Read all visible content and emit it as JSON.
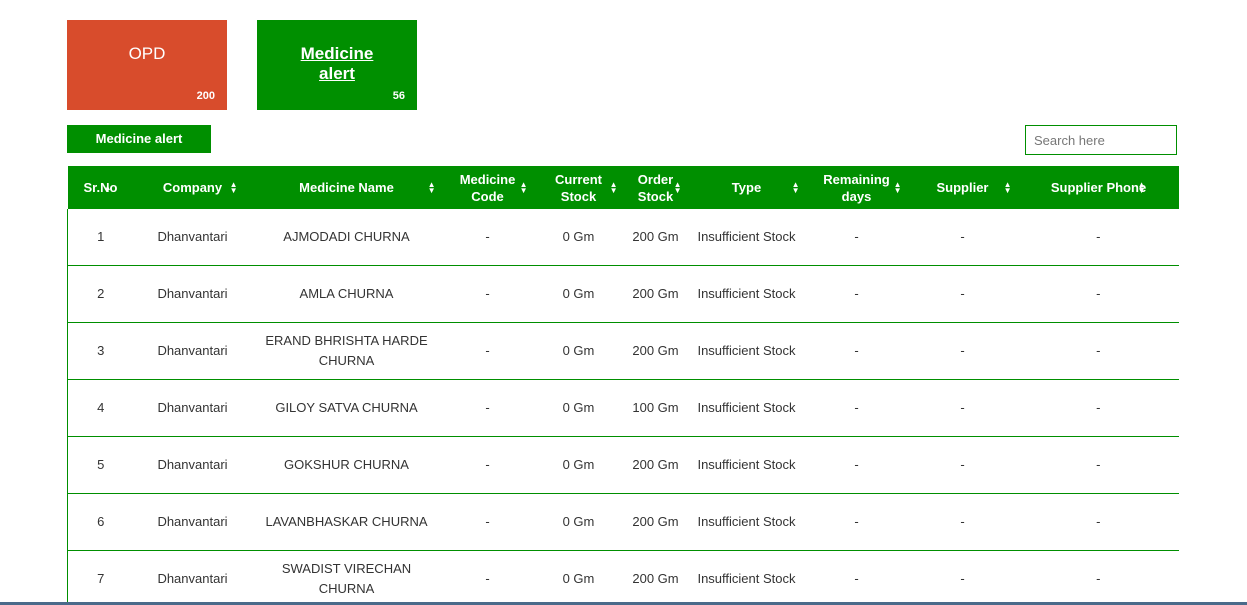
{
  "tiles": {
    "opd": {
      "label": "OPD",
      "count": "200"
    },
    "medicine_alert": {
      "label": "Medicine alert",
      "count": "56"
    }
  },
  "section_button": "Medicine alert",
  "search": {
    "placeholder": "Search here",
    "value": ""
  },
  "table": {
    "columns": [
      "Sr.No",
      "Company",
      "Medicine Name",
      "Medicine Code",
      "Current Stock",
      "Order Stock",
      "Type",
      "Remaining days",
      "Supplier",
      "Supplier Phone"
    ],
    "rows": [
      [
        "1",
        "Dhanvantari",
        "AJMODADI CHURNA",
        "-",
        "0 Gm",
        "200 Gm",
        "Insufficient Stock",
        "-",
        "-",
        "-"
      ],
      [
        "2",
        "Dhanvantari",
        "AMLA CHURNA",
        "-",
        "0 Gm",
        "200 Gm",
        "Insufficient Stock",
        "-",
        "-",
        "-"
      ],
      [
        "3",
        "Dhanvantari",
        "ERAND BHRISHTA HARDE CHURNA",
        "-",
        "0 Gm",
        "200 Gm",
        "Insufficient Stock",
        "-",
        "-",
        "-"
      ],
      [
        "4",
        "Dhanvantari",
        "GILOY SATVA CHURNA",
        "-",
        "0 Gm",
        "100 Gm",
        "Insufficient Stock",
        "-",
        "-",
        "-"
      ],
      [
        "5",
        "Dhanvantari",
        "GOKSHUR CHURNA",
        "-",
        "0 Gm",
        "200 Gm",
        "Insufficient Stock",
        "-",
        "-",
        "-"
      ],
      [
        "6",
        "Dhanvantari",
        "LAVANBHASKAR CHURNA",
        "-",
        "0 Gm",
        "200 Gm",
        "Insufficient Stock",
        "-",
        "-",
        "-"
      ],
      [
        "7",
        "Dhanvantari",
        "SWADIST VIRECHAN CHURNA",
        "-",
        "0 Gm",
        "200 Gm",
        "Insufficient Stock",
        "-",
        "-",
        "-"
      ]
    ]
  },
  "colors": {
    "green": "#008f00",
    "orange": "#d84c2c"
  }
}
